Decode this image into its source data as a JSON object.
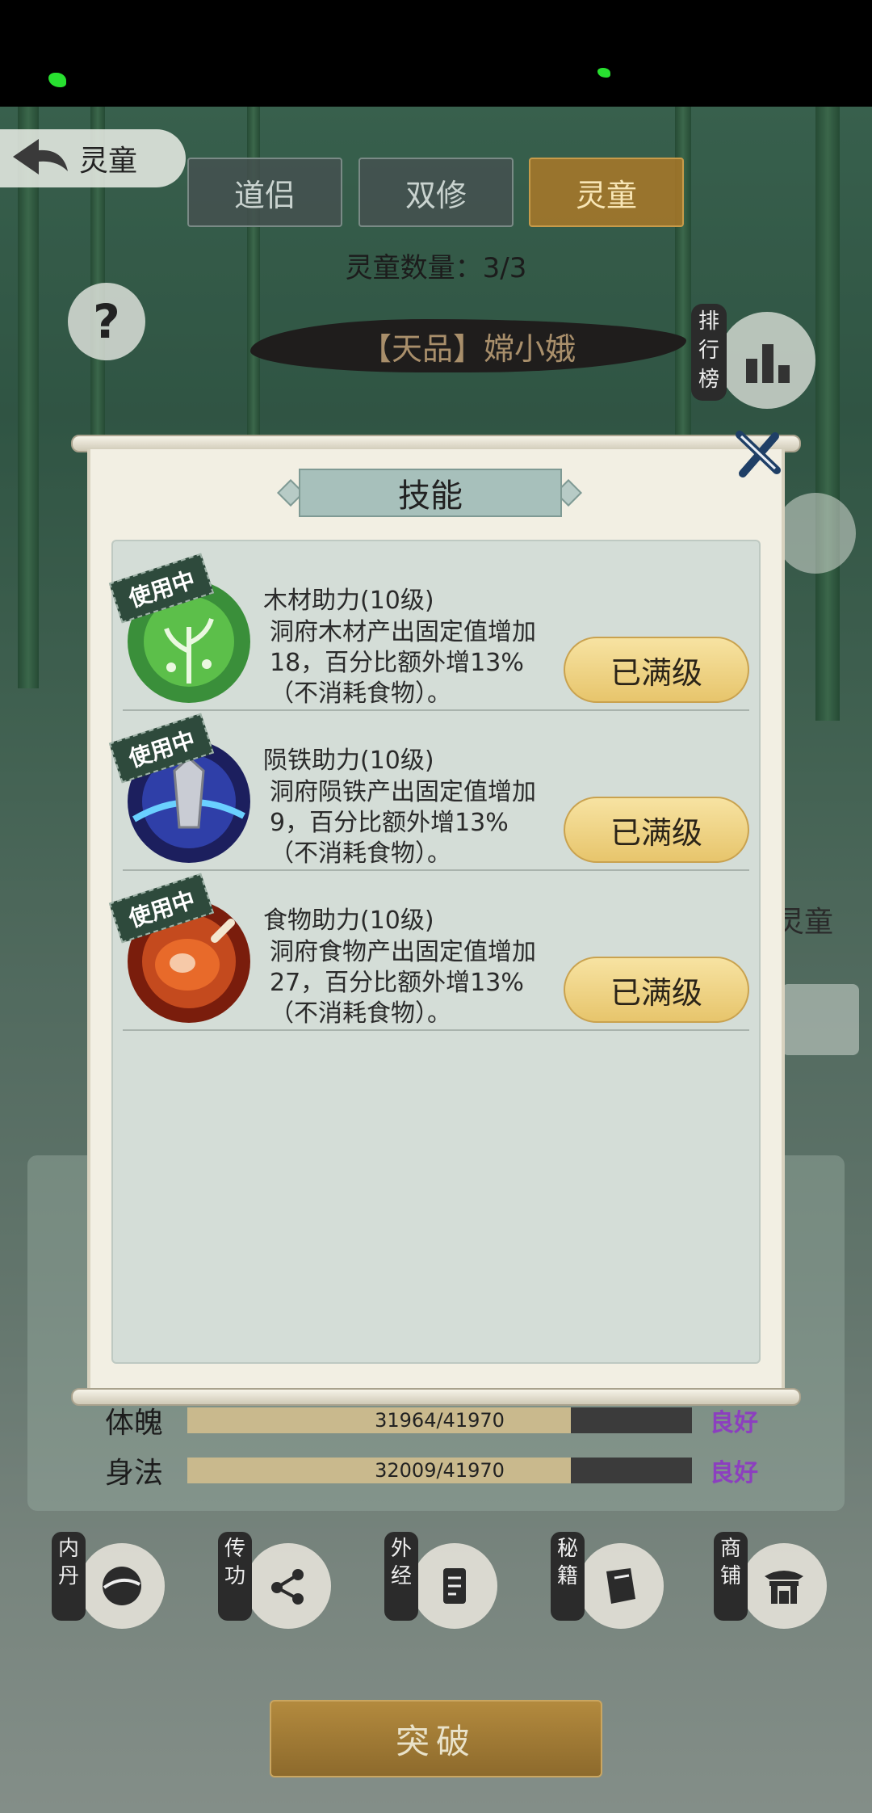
{
  "header": {
    "back_title": "灵童"
  },
  "tabs": [
    {
      "label": "道侣",
      "active": false
    },
    {
      "label": "双修",
      "active": false
    },
    {
      "label": "灵童",
      "active": true
    }
  ],
  "child_count": "灵童数量：3/3",
  "help_label": "?",
  "child_name": "【天品】嫦小娥",
  "rank": {
    "label": "排行榜"
  },
  "side": {
    "text": "灵童"
  },
  "stats": [
    {
      "label": "体魄",
      "value": "31964/41970",
      "fraction": 0.76,
      "grade": "良好"
    },
    {
      "label": "身法",
      "value": "32009/41970",
      "fraction": 0.76,
      "grade": "良好"
    }
  ],
  "features": [
    {
      "label": "内丹",
      "icon": "inner-elixir-icon"
    },
    {
      "label": "传功",
      "icon": "share-skill-icon"
    },
    {
      "label": "外经",
      "icon": "scroll-icon"
    },
    {
      "label": "秘籍",
      "icon": "book-icon"
    },
    {
      "label": "商铺",
      "icon": "shop-icon"
    }
  ],
  "breakthrough_label": "突破",
  "modal": {
    "title": "技能",
    "skills": [
      {
        "tag": "使用中",
        "name": "木材助力(10级)",
        "desc": "洞府木材产出固定值增加18，百分比额外增13%（不消耗食物）。",
        "button": "已满级",
        "icon": "wood-boost-icon",
        "color": "#3a8f3a"
      },
      {
        "tag": "使用中",
        "name": "陨铁助力(10级)",
        "desc": "洞府陨铁产出固定值增加9，百分比额外增13%（不消耗食物）。",
        "button": "已满级",
        "icon": "meteor-iron-icon",
        "color": "#2f3fa8"
      },
      {
        "tag": "使用中",
        "name": "食物助力(10级)",
        "desc": "洞府食物产出固定值增加27，百分比额外增13%（不消耗食物）。",
        "button": "已满级",
        "icon": "food-boost-icon",
        "color": "#c44a1e"
      }
    ]
  }
}
